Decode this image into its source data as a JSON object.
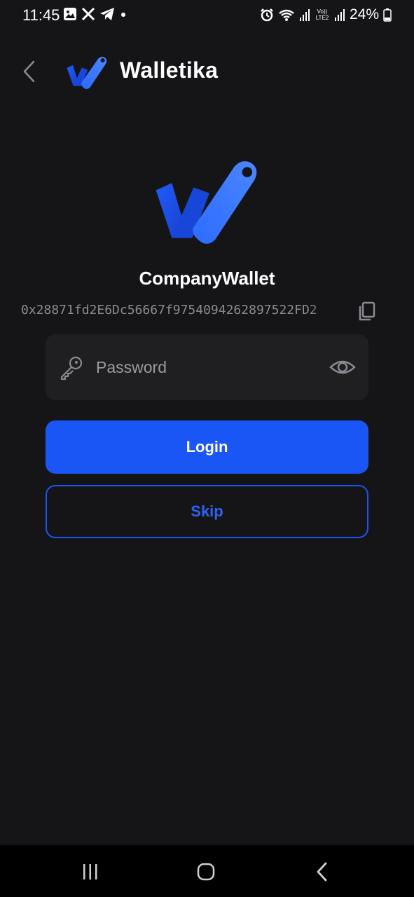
{
  "status_bar": {
    "time": "11:45",
    "battery": "24%",
    "network_label": "Vo)) LTE2",
    "left_icons": [
      "image-icon",
      "x-logo-icon",
      "telegram-icon",
      "dot-icon"
    ],
    "right_icons": [
      "alarm-icon",
      "wifi-icon",
      "signal-icon",
      "signal-icon",
      "battery-icon"
    ]
  },
  "header": {
    "title": "Walletika",
    "back_icon": "chevron-left-icon",
    "logo": "walletika-logo"
  },
  "wallet": {
    "name": "CompanyWallet",
    "address": "0x28871fd2E6Dc56667f9754094262897522FD2",
    "copy_icon": "copy-icon"
  },
  "password": {
    "placeholder": "Password",
    "value": "",
    "key_icon": "key-icon",
    "eye_icon": "eye-icon"
  },
  "buttons": {
    "login_label": "Login",
    "skip_label": "Skip"
  },
  "nav": {
    "items": [
      "recent-apps-icon",
      "home-icon",
      "back-icon"
    ]
  },
  "colors": {
    "background": "#151518",
    "accent": "#1a56f5",
    "field": "#1f1f22",
    "muted_text": "#8a8a92"
  }
}
